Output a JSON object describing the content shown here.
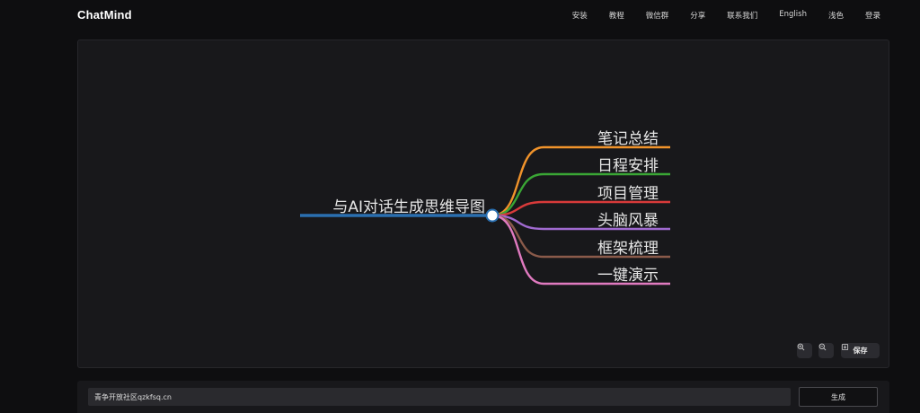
{
  "header": {
    "logo": "ChatMind",
    "nav": [
      {
        "label": "安装",
        "name": "nav-install"
      },
      {
        "label": "教程",
        "name": "nav-tutorial"
      },
      {
        "label": "微信群",
        "name": "nav-wechat-group"
      },
      {
        "label": "分享",
        "name": "nav-share"
      },
      {
        "label": "联系我们",
        "name": "nav-contact"
      },
      {
        "label": "English",
        "name": "nav-english"
      },
      {
        "label": "浅色",
        "name": "nav-light-theme"
      },
      {
        "label": "登录",
        "name": "nav-login"
      }
    ]
  },
  "mindmap": {
    "root": {
      "label": "与AI对话生成思维导图",
      "color": "#2a6fb0"
    },
    "branches": [
      {
        "label": "笔记总结",
        "color": "#f0932b"
      },
      {
        "label": "日程安排",
        "color": "#3aa635"
      },
      {
        "label": "项目管理",
        "color": "#d83a3a"
      },
      {
        "label": "头脑风暴",
        "color": "#a06ad0"
      },
      {
        "label": "框架梳理",
        "color": "#8a5a4a"
      },
      {
        "label": "一键演示",
        "color": "#e07ac0"
      }
    ]
  },
  "toolbar": {
    "zoom_in_icon": "zoom-in-icon",
    "zoom_out_icon": "zoom-out-icon",
    "save_label": "保存"
  },
  "prompt": {
    "value": "青争开放社区qzkfsq.cn",
    "generate_label": "生成"
  }
}
